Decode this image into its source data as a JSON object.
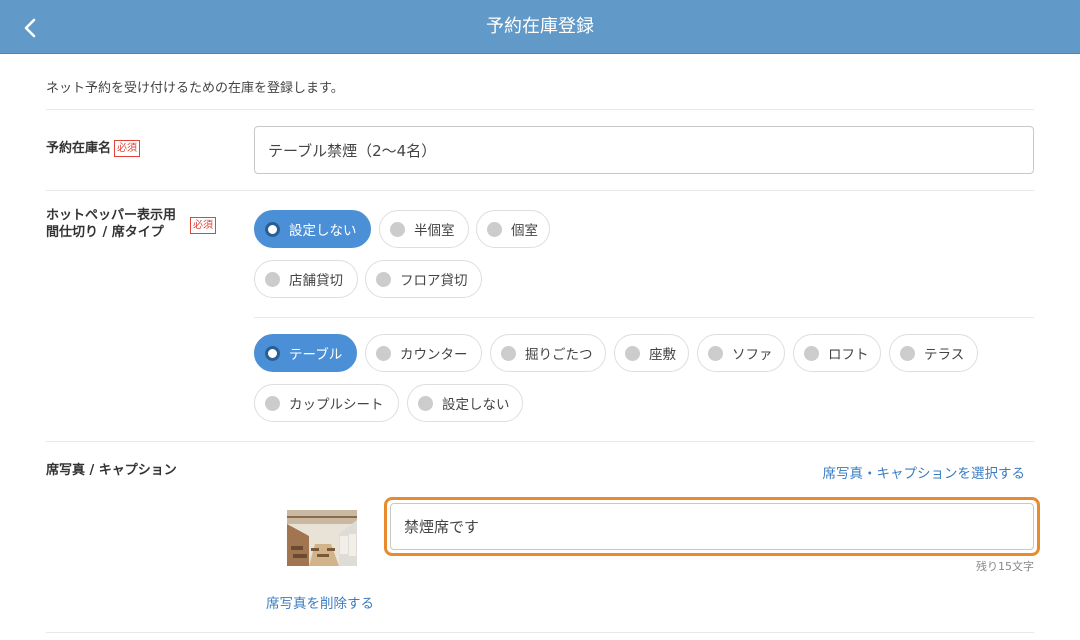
{
  "header": {
    "title": "予約在庫登録",
    "back_icon": "chevron-left-icon"
  },
  "intro_text": "ネット予約を受け付けるための在庫を登録します。",
  "required_label": "必須",
  "inventory_name": {
    "label": "予約在庫名",
    "value": "テーブル禁煙（2〜4名）"
  },
  "hotpepper": {
    "label_line1": "ホットペッパー表示用",
    "label_line2": "間仕切り / 席タイプ",
    "partition_options": [
      {
        "label": "設定しない",
        "selected": true
      },
      {
        "label": "半個室",
        "selected": false
      },
      {
        "label": "個室",
        "selected": false
      },
      {
        "label": "店舗貸切",
        "selected": false
      },
      {
        "label": "フロア貸切",
        "selected": false
      }
    ],
    "seat_options": [
      {
        "label": "テーブル",
        "selected": true
      },
      {
        "label": "カウンター",
        "selected": false
      },
      {
        "label": "掘りごたつ",
        "selected": false
      },
      {
        "label": "座敷",
        "selected": false
      },
      {
        "label": "ソファ",
        "selected": false
      },
      {
        "label": "ロフト",
        "selected": false
      },
      {
        "label": "テラス",
        "selected": false
      },
      {
        "label": "カップルシート",
        "selected": false
      },
      {
        "label": "設定しない",
        "selected": false
      }
    ]
  },
  "photo_section": {
    "label": "席写真 / キャプション",
    "select_link": "席写真・キャプションを選択する",
    "caption_value": "禁煙席です",
    "remaining": "残り15文字",
    "delete_link": "席写真を削除する"
  },
  "colors": {
    "header_bg": "#6199c8",
    "selected_chip": "#4b90d6",
    "link": "#3a7cc0",
    "required": "#e0443a",
    "focus_border": "#e88a2e"
  }
}
